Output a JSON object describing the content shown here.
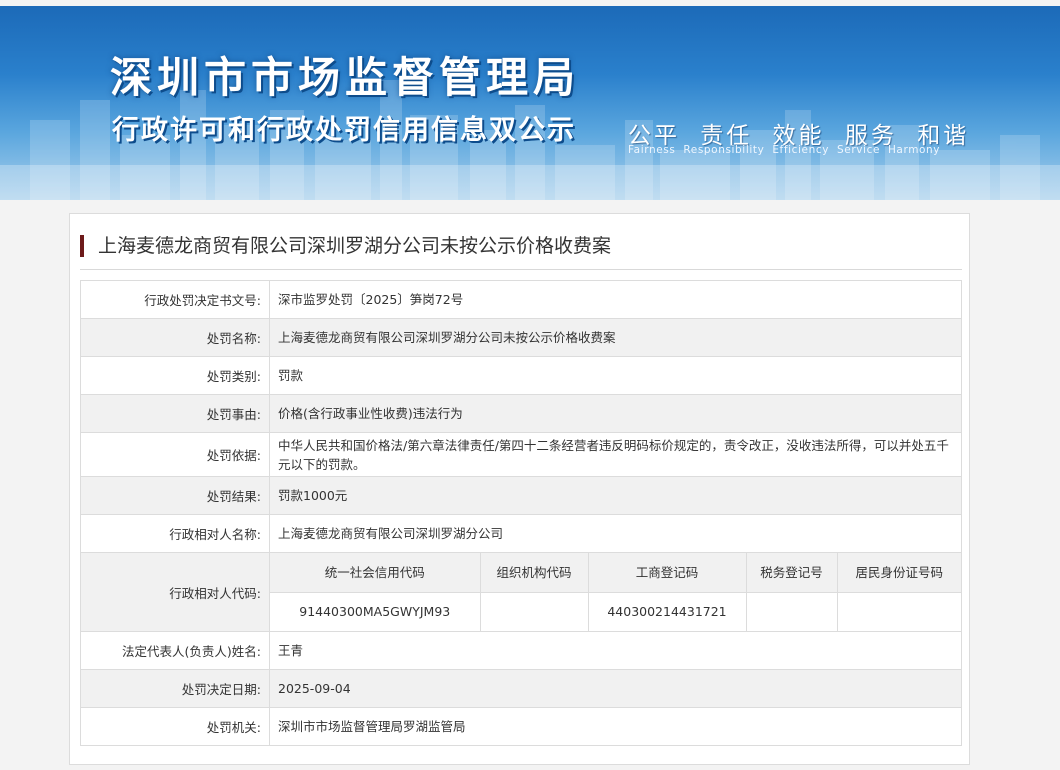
{
  "banner": {
    "title": "深圳市市场监督管理局",
    "subtitle": "行政许可和行政处罚信用信息双公示",
    "slogan_cn": "公平 责任 效能 服务 和谐",
    "slogan_en": "Fairness Responsibility Efficiency Service Harmony"
  },
  "case_title": "上海麦德龙商贸有限公司深圳罗湖分公司未按公示价格收费案",
  "fields": {
    "decision_no": {
      "label": "行政处罚决定书文号:",
      "value": "深市监罗处罚〔2025〕笋岗72号"
    },
    "penalty_name": {
      "label": "处罚名称:",
      "value": "上海麦德龙商贸有限公司深圳罗湖分公司未按公示价格收费案"
    },
    "penalty_type": {
      "label": "处罚类别:",
      "value": "罚款"
    },
    "penalty_reason": {
      "label": "处罚事由:",
      "value": "价格(含行政事业性收费)违法行为"
    },
    "penalty_basis": {
      "label": "处罚依据:",
      "value": "中华人民共和国价格法/第六章法律责任/第四十二条经营者违反明码标价规定的，责令改正，没收违法所得，可以并处五千元以下的罚款。"
    },
    "penalty_result": {
      "label": "处罚结果:",
      "value": "罚款1000元"
    },
    "counterpart_name": {
      "label": "行政相对人名称:",
      "value": "上海麦德龙商贸有限公司深圳罗湖分公司"
    },
    "counterpart_code": {
      "label": "行政相对人代码:",
      "headers": [
        "统一社会信用代码",
        "组织机构代码",
        "工商登记码",
        "税务登记号",
        "居民身份证号码"
      ],
      "values": [
        "91440300MA5GWYJM93",
        "",
        "440300214431721",
        "",
        ""
      ]
    },
    "legal_rep": {
      "label": "法定代表人(负责人)姓名:",
      "value": "王青"
    },
    "decision_date": {
      "label": "处罚决定日期:",
      "value": "2025-09-04"
    },
    "authority": {
      "label": "处罚机关:",
      "value": "深圳市市场监督管理局罗湖监管局"
    }
  }
}
